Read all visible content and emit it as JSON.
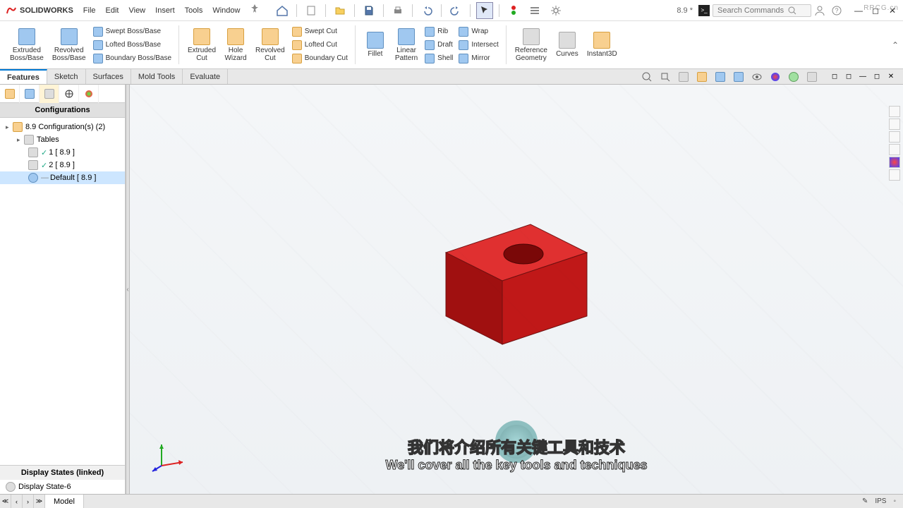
{
  "app": {
    "name": "SOLIDWORKS",
    "doc_title": "8.9 *"
  },
  "menu": [
    "File",
    "Edit",
    "View",
    "Insert",
    "Tools",
    "Window"
  ],
  "search": {
    "placeholder": "Search Commands"
  },
  "ribbon": {
    "features_big": [
      {
        "label": "Extruded\nBoss/Base"
      },
      {
        "label": "Revolved\nBoss/Base"
      }
    ],
    "boss_list": [
      "Swept Boss/Base",
      "Lofted Boss/Base",
      "Boundary Boss/Base"
    ],
    "cut_big": [
      {
        "label": "Extruded\nCut"
      },
      {
        "label": "Hole\nWizard"
      },
      {
        "label": "Revolved\nCut"
      }
    ],
    "cut_list": [
      "Swept Cut",
      "Lofted Cut",
      "Boundary Cut"
    ],
    "mid_big": [
      {
        "label": "Fillet"
      },
      {
        "label": "Linear\nPattern"
      }
    ],
    "mid_list": [
      "Rib",
      "Draft",
      "Shell"
    ],
    "mid_list2": [
      "Wrap",
      "Intersect",
      "Mirror"
    ],
    "right_big": [
      {
        "label": "Reference\nGeometry"
      },
      {
        "label": "Curves"
      },
      {
        "label": "Instant3D"
      }
    ]
  },
  "tabs": [
    "Features",
    "Sketch",
    "Surfaces",
    "Mold Tools",
    "Evaluate"
  ],
  "active_tab": "Features",
  "config_panel": {
    "title": "Configurations",
    "root": "8.9 Configuration(s)  (2)",
    "tables": "Tables",
    "rows": [
      {
        "label": "1 [ 8.9 ]",
        "checked": true
      },
      {
        "label": "2 [ 8.9 ]",
        "checked": true
      },
      {
        "label": "Default [ 8.9 ]",
        "checked": false,
        "selected": true
      }
    ]
  },
  "display_states": {
    "title": "Display States (linked)",
    "row": "Display State-6"
  },
  "bottom": {
    "tab": "Model",
    "units": "IPS"
  },
  "subtitle": {
    "cn": "我们将介绍所有关键工具和技术",
    "en": "We'll cover all the key tools and techniques"
  },
  "watermark_text": "RRCG.cn"
}
